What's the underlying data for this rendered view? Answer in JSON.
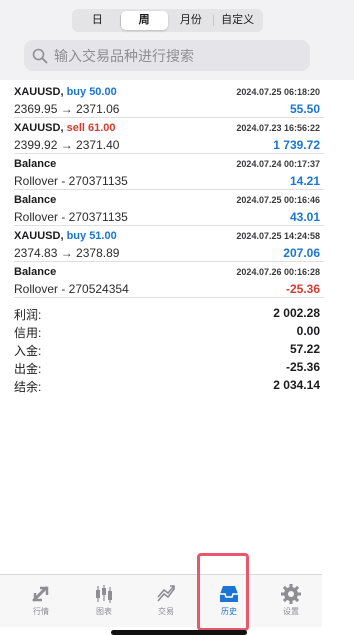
{
  "period_tabs": [
    {
      "label": "日",
      "active": false
    },
    {
      "label": "周",
      "active": true
    },
    {
      "label": "月份",
      "active": false
    },
    {
      "label": "自定义",
      "active": false
    }
  ],
  "search": {
    "placeholder": "输入交易品种进行搜索"
  },
  "deals": [
    {
      "title": "XAUUSD,",
      "action": "buy 50.00",
      "action_type": "buy",
      "detail": "2369.95 → 2371.06",
      "time": "2024.07.25 06:18:20",
      "profit": "55.50",
      "profit_sign": "pos"
    },
    {
      "title": "XAUUSD,",
      "action": "sell 61.00",
      "action_type": "sell",
      "detail": "2399.92 → 2371.40",
      "time": "2024.07.23 16:56:22",
      "profit": "1 739.72",
      "profit_sign": "pos"
    },
    {
      "title": "Balance",
      "action": "",
      "action_type": "",
      "detail": "Rollover - 270371135",
      "time": "2024.07.24 00:17:37",
      "profit": "14.21",
      "profit_sign": "pos"
    },
    {
      "title": "Balance",
      "action": "",
      "action_type": "",
      "detail": "Rollover - 270371135",
      "time": "2024.07.25 00:16:46",
      "profit": "43.01",
      "profit_sign": "pos"
    },
    {
      "title": "XAUUSD,",
      "action": "buy 51.00",
      "action_type": "buy",
      "detail": "2374.83 → 2378.89",
      "time": "2024.07.25 14:24:58",
      "profit": "207.06",
      "profit_sign": "pos"
    },
    {
      "title": "Balance",
      "action": "",
      "action_type": "",
      "detail": "Rollover - 270524354",
      "time": "2024.07.26 00:16:28",
      "profit": "-25.36",
      "profit_sign": "neg"
    }
  ],
  "summary": [
    {
      "label": "利润:",
      "value": "2 002.28"
    },
    {
      "label": "信用:",
      "value": "0.00"
    },
    {
      "label": "入金:",
      "value": "57.22"
    },
    {
      "label": "出金:",
      "value": "-25.36"
    },
    {
      "label": "结余:",
      "value": "2 034.14"
    }
  ],
  "tabbar": [
    {
      "label": "行情",
      "icon": "quotes-icon",
      "active": false
    },
    {
      "label": "图表",
      "icon": "chart-icon",
      "active": false
    },
    {
      "label": "交易",
      "icon": "trade-icon",
      "active": false
    },
    {
      "label": "历史",
      "icon": "history-icon",
      "active": true
    },
    {
      "label": "设置",
      "icon": "settings-icon",
      "active": false
    }
  ],
  "colors": {
    "accent": "#1a76d2",
    "loss": "#d63a2f",
    "highlight": "#e8576b"
  }
}
